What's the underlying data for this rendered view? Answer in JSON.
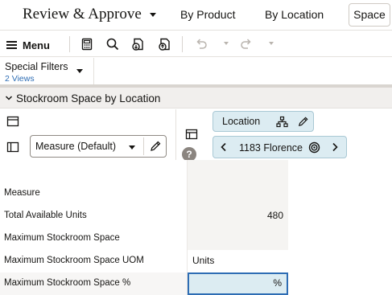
{
  "header": {
    "title": "Review & Approve",
    "tabs": [
      "By Product",
      "By Location",
      "Space"
    ]
  },
  "toolbar": {
    "menu_label": "Menu",
    "icons": [
      "calculator-icon",
      "search-icon",
      "import-icon",
      "export-icon",
      "undo-icon",
      "redo-icon"
    ]
  },
  "filters": {
    "title": "Special Filters",
    "subtitle": "2 Views"
  },
  "section": {
    "title": "Stockroom Space by Location"
  },
  "layout": {
    "measure_select": "Measure (Default)",
    "location_chip": "Location",
    "location_value": "1183 Florence",
    "help": "?"
  },
  "grid": {
    "header_label": "Measure",
    "rows": [
      {
        "label": "Total Available Units",
        "value": "480"
      },
      {
        "label": "Maximum Stockroom Space",
        "value": ""
      },
      {
        "label": "Maximum Stockroom Space UOM",
        "value": "Units"
      },
      {
        "label": "Maximum Stockroom Space %",
        "value": "%"
      }
    ]
  },
  "colors": {
    "accent": "#2e6db4",
    "chip_bg": "#dcecf2",
    "cell_bg": "#f5f4f2",
    "section_bg": "#f1efed"
  }
}
